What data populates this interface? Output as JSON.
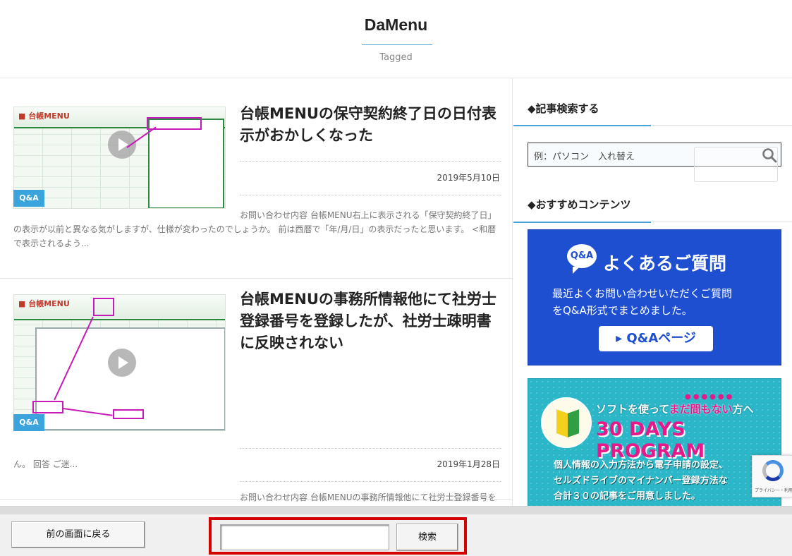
{
  "header": {
    "title": "DaMenu",
    "subtitle": "Tagged"
  },
  "articles": [
    {
      "title": "台帳MENUの保守契約終了日の日付表示がおかしくなった",
      "date": "2019年5月10日",
      "category": "Q&A",
      "excerpt": "お問い合わせ内容 台帳MENU右上に表示される「保守契約終了日」の表示が以前と異なる気がしますが、仕様が変わったのでしょうか。 前は西暦で「年/月/日」の表示だったと思います。 <和暦で表示されるよう..."
    },
    {
      "title": "台帳MENUの事務所情報他にて社労士登録番号を登録したが、社労士疎明書に反映されない",
      "date": "2019年1月28日",
      "category": "Q&A",
      "excerpt_a": "お問い合わせ内容 台帳MENUの事務所情報他にて社労士登録番号を登録しましたが、事業所ファイルのFD・電子申請関連より社労士疎明書を作成し出力してみると、社労士登録番号の欄に反映しませ",
      "excerpt_b": "ん。 回答 ご迷..."
    }
  ],
  "sidebar": {
    "search_heading": "◆記事検索する",
    "search_placeholder": "例：パソコン　入れ替え",
    "recommend_heading": "◆おすすめコンテンツ",
    "banner_qa": {
      "bubble": "Q&A",
      "title": "よくあるご質問",
      "line1": "最近よくお問い合わせいただくご質問",
      "line2": "をQ&A形式でまとめました。",
      "button": "▸ Q&Aページ"
    },
    "banner_30days": {
      "sub_a": "ソフトを使って",
      "sub_b": "まだ間もない",
      "sub_c": "方へ",
      "big": "30 DAYS PROGRAM",
      "line1": "個人情報の入力方法から電子申請の設定、",
      "line2": "セルズドライブのマイナンバー登録方法な",
      "line3": "合計３０の記事をご用意しました。"
    },
    "recaptcha_text": "プライバシー・利用規約"
  },
  "bottombar": {
    "back_label": "前の画面に戻る",
    "search_value": "",
    "search_button": "検索"
  },
  "colors": {
    "accent_blue": "#4aa3d8",
    "badge": "#3ba4dc",
    "banner_blue": "#1f4fd1",
    "banner_teal": "#2cb7c9",
    "highlight_red": "#d50000"
  }
}
